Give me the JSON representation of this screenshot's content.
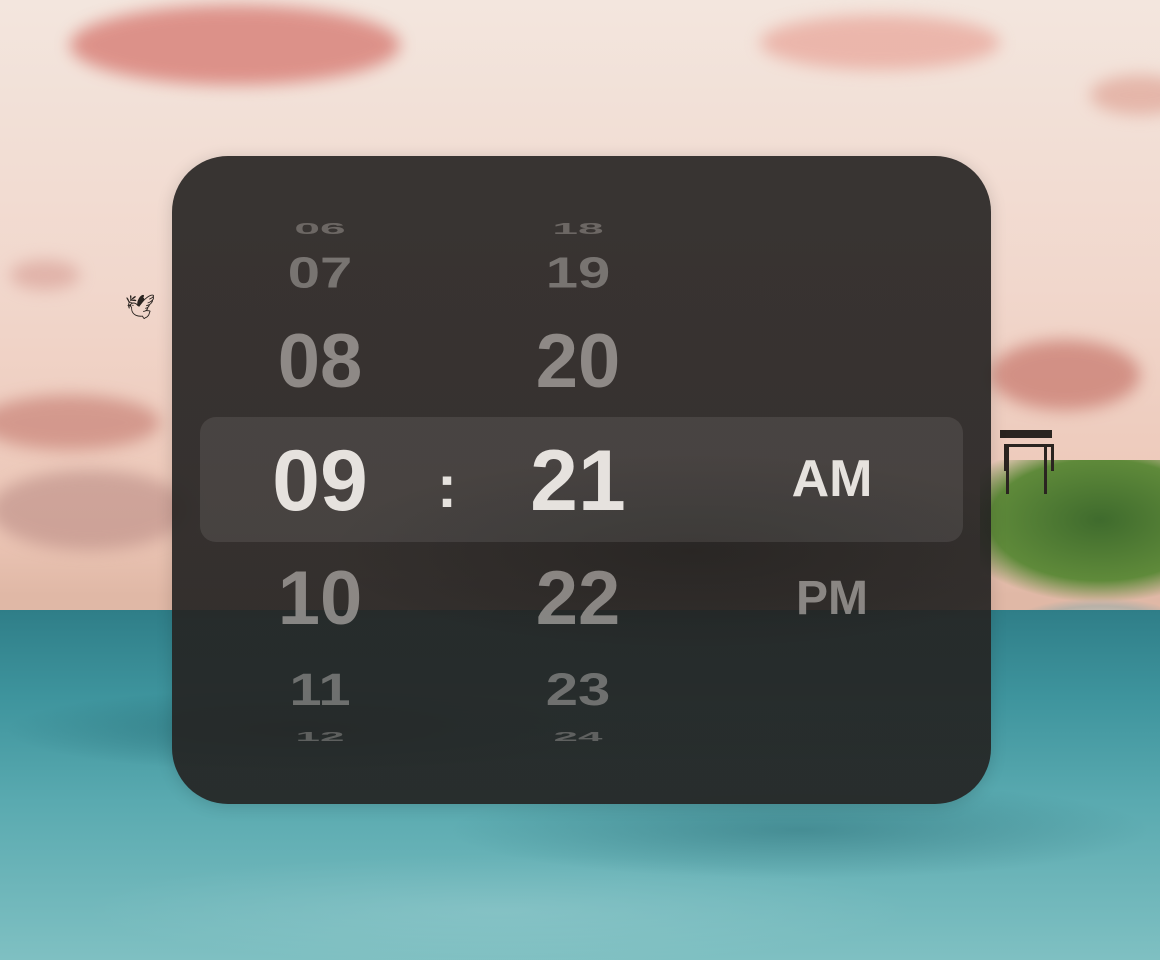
{
  "time_picker": {
    "hours": [
      "06",
      "07",
      "08",
      "09",
      "10",
      "11",
      "12"
    ],
    "separator": ":",
    "minutes": [
      "18",
      "19",
      "20",
      "21",
      "22",
      "23",
      "24"
    ],
    "periods": [
      "AM",
      "PM"
    ],
    "selected": {
      "hour": "09",
      "minute": "21",
      "period": "AM"
    }
  },
  "background": {
    "sky_color": "#f1d7cc",
    "sea_color": "#3e949d",
    "panel_color": "#28251f"
  }
}
